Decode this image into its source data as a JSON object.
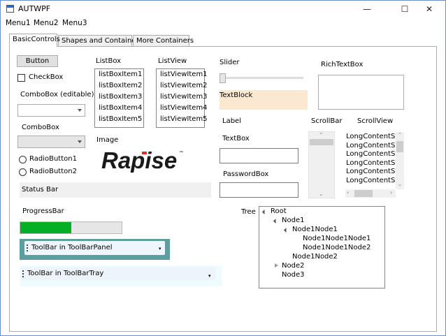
{
  "window": {
    "title": "AUTWPF",
    "minimize": "—",
    "maximize": "☐",
    "close": "✕"
  },
  "menu": [
    "Menu1",
    "Menu2",
    "Menu3"
  ],
  "tabs": [
    "BasicControls",
    "Shapes and Containers",
    "More Containers"
  ],
  "basic": {
    "button_label": "Button",
    "checkbox_label": "CheckBox",
    "combo_editable_label": "ComboBox (editable)",
    "combo_label": "ComboBox",
    "radio1": "RadioButton1",
    "radio2": "RadioButton2",
    "status_bar": "Status Bar",
    "progress_label": "ProgressBar",
    "progress_value": 0.5,
    "toolbar_panel_label": "ToolBar in ToolBarPanel",
    "toolbar_tray_label": "ToolBar in ToolBarTray",
    "listbox_label": "ListBox",
    "listbox_items": [
      "listBoxItem1",
      "listBoxItem2",
      "listBoxItem3",
      "listBoxItem4",
      "listBoxItem5"
    ],
    "listview_label": "ListView",
    "listview_items": [
      "listViewItem1",
      "listViewItem2",
      "listViewItem3",
      "listViewItem4",
      "listViewItem5"
    ],
    "image_label": "Image",
    "logo_text": "Rapise",
    "logo_tm": "™",
    "slider_label": "Slider",
    "textblock": "TextBlock",
    "label": "Label",
    "textbox_label": "TextBox",
    "passwordbox_label": "PasswordBox",
    "richtextbox_label": "RichTextBox",
    "scrollbar_label": "ScrollBar",
    "scrollview_label": "ScrollView",
    "scrollview_items": [
      "LongContentStri",
      "LongContentStri",
      "LongContentStri",
      "LongContentStri",
      "LongContentStri",
      "LongContentStri"
    ],
    "tree_label": "Tree",
    "tree": [
      "Root",
      "Node1",
      "Node1Node1",
      "Node1Node1Node1",
      "Node1Node1Node2",
      "Node1Node2",
      "Node2",
      "Node3"
    ]
  },
  "colors": {
    "progress_fill": "#06b025",
    "textblock_bg": "#fbe8d0",
    "statusbar_bg": "#f0f0f0",
    "toolbarpanel_bg": "#5f9ea0",
    "toolbartray_bg": "#f0fbff",
    "logo_red": "#e32b2b"
  }
}
